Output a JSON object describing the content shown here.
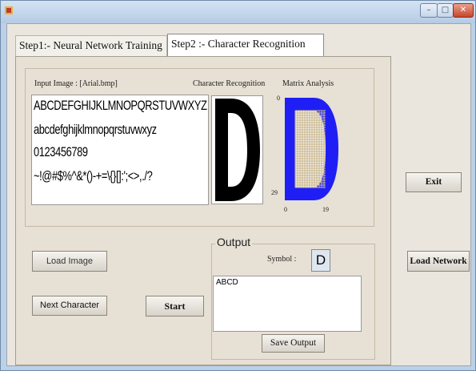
{
  "window": {
    "controls": [
      "–",
      "□",
      "✕"
    ]
  },
  "tabs": [
    {
      "label": "Step1:- Neural Network Training"
    },
    {
      "label": "Step2 :- Character Recognition"
    }
  ],
  "recognition": {
    "input_label": "Input Image : [Arial.bmp]",
    "char_label": "Character Recognition",
    "matrix_label": "Matrix Analysis",
    "sample_lines": [
      "ABCDEFGHIJKLMNOPQRSTUVWXYZ",
      "abcdefghijklmnopqrstuvwxyz",
      "0123456789",
      "~!@#$%^&*()-+=\\{}[]:';<>,./?"
    ],
    "recognized_char": "D",
    "matrix_axis": {
      "y_top": "0",
      "y_bottom": "29",
      "x_left": "0",
      "x_right": "19"
    }
  },
  "buttons": {
    "load_image": "Load Image",
    "next_char": "Next Character",
    "start": "Start",
    "exit": "Exit",
    "load_network": "Load Network",
    "save_output": "Save Output"
  },
  "output": {
    "title": "Output",
    "symbol_label": "Symbol :",
    "symbol_value": "D",
    "text": "ABCD"
  },
  "colors": {
    "matrix_blue": "#1f1ff5",
    "matrix_grid": "#c8b48a"
  }
}
